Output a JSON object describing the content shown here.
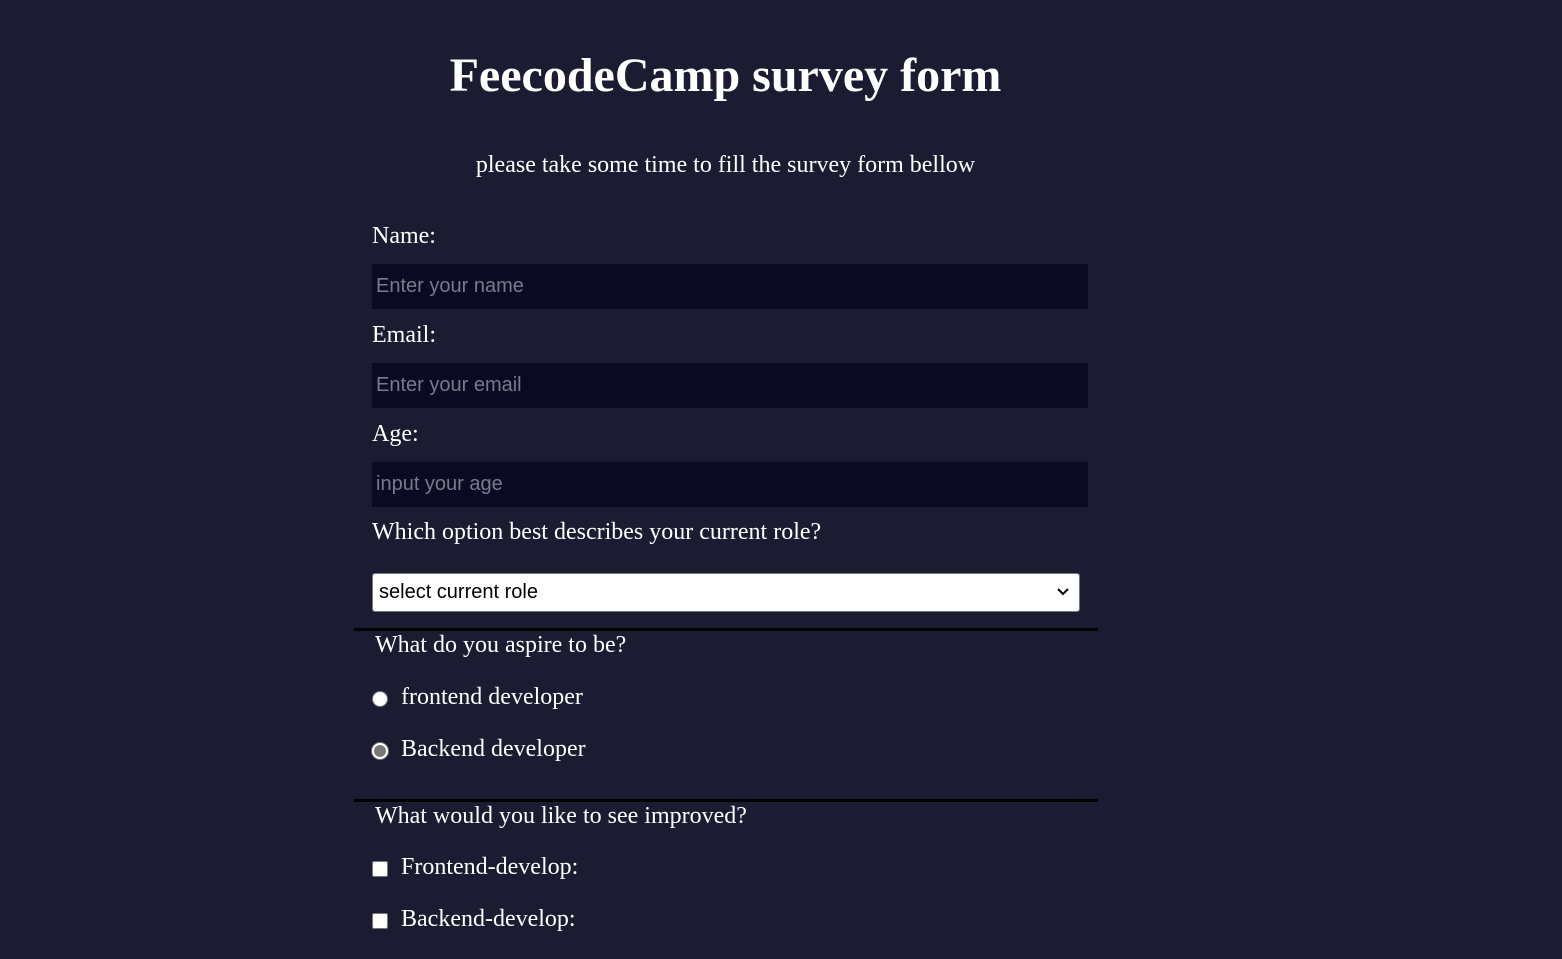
{
  "header": {
    "title": "FeecodeCamp survey form",
    "description": "please take some time to fill the survey form bellow"
  },
  "form": {
    "name": {
      "label": "Name:",
      "placeholder": "Enter your name",
      "value": ""
    },
    "email": {
      "label": "Email:",
      "placeholder": "Enter your email",
      "value": ""
    },
    "age": {
      "label": "Age:",
      "placeholder": "input your age",
      "value": ""
    },
    "role": {
      "label": "Which option best describes your current role?",
      "selected": "select current role"
    },
    "aspire": {
      "question": "What do you aspire to be?",
      "options": [
        {
          "label": "frontend developer",
          "checked": false
        },
        {
          "label": "Backend developer",
          "checked": false
        }
      ]
    },
    "improve": {
      "question": "What would you like to see improved?",
      "options": [
        {
          "label": "Frontend-develop:",
          "checked": false
        },
        {
          "label": "Backend-develop:",
          "checked": false
        }
      ]
    }
  },
  "colors": {
    "background": "#1b1b32",
    "input_background": "#0a0a23",
    "text": "#ffffff",
    "divider": "#000000"
  },
  "icons": {
    "select_arrow": "chevron-down-icon"
  }
}
